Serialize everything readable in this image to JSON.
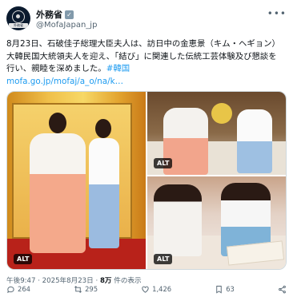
{
  "account": {
    "display_name": "外務省",
    "verified_mark": "✓",
    "handle": "@MofaJapan_jp",
    "avatar_label": "外務省"
  },
  "tweet": {
    "line1": "8月23日、石破佳子総理大臣夫人は、訪日中の金恵景（キム・ヘギョン）",
    "line2": "大韓民国大統領夫人を迎え、「結び」に関連した伝統工芸体験及び懇談を",
    "line3": "行い、親睦を深めました。",
    "hashtag": "#韓国",
    "url": "mofa.go.jp/mofaj/a_o/na/k…"
  },
  "media": {
    "alt_badge": "ALT",
    "images": [
      {
        "name": "photo-left",
        "alt": "ALT"
      },
      {
        "name": "photo-top-right",
        "alt": "ALT"
      },
      {
        "name": "photo-bottom-right",
        "alt": "ALT"
      }
    ]
  },
  "meta": {
    "time_date": "午後9:47 · 2025年8月23日 · ",
    "views": "8万",
    "views_suffix": " 件の表示"
  },
  "actions": {
    "replies": "264",
    "reposts": "295",
    "likes": "1,426",
    "bookmarks": "63"
  },
  "icons": {
    "more": "more-icon",
    "reply": "reply-icon",
    "repost": "repost-icon",
    "like": "like-icon",
    "bookmark": "bookmark-icon",
    "share": "share-icon"
  }
}
